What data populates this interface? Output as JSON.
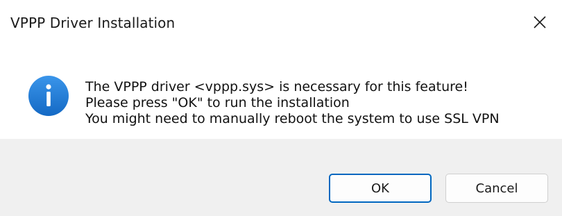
{
  "window": {
    "title": "VPPP Driver Installation",
    "close_icon": "close-icon"
  },
  "message": {
    "icon": "info-icon",
    "icon_color": "#1e78d6",
    "lines": [
      "The VPPP driver <vppp.sys> is necessary for this feature!",
      "Please press \"OK\" to run the installation",
      "You might need to manually reboot the system to use SSL VPN"
    ]
  },
  "buttons": {
    "ok_label": "OK",
    "cancel_label": "Cancel",
    "default_border_color": "#0067c0"
  }
}
